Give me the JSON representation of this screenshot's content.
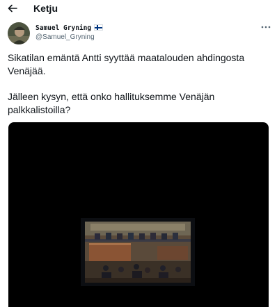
{
  "header": {
    "title": "Ketju",
    "back_icon": "arrow-left-icon"
  },
  "author": {
    "display_name": "Samuel Gryning",
    "flag_icon": "finland-flag-icon",
    "handle": "@Samuel_Gryning"
  },
  "tweet": {
    "paragraphs": [
      "Sikatilan emäntä Antti syyttää maatalouden ahdingosta Venäjää.",
      "Jälleen kysyn, että onko hallituksemme Venäjän palkkalistoilla?"
    ]
  },
  "menu": {
    "more_icon": "more-horizontal-icon"
  },
  "media": {
    "type": "video",
    "colors": {
      "background": "#000000"
    }
  }
}
